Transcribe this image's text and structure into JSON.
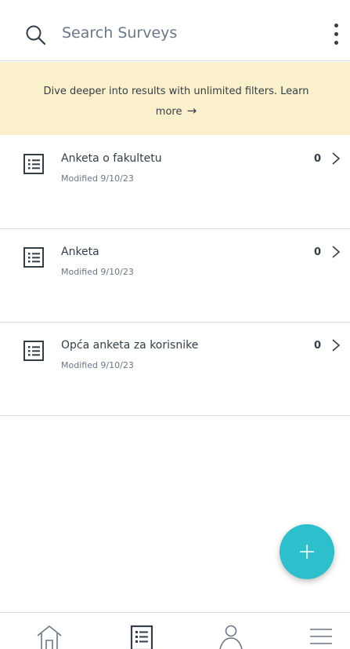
{
  "search": {
    "placeholder": "Search Surveys",
    "icon": "search-icon",
    "menu_icon": "more-vertical-icon"
  },
  "banner": {
    "text": "Dive deeper into results with unlimited filters. Learn more",
    "arrow": "→",
    "background_color": "#fbf0cc"
  },
  "surveys": [
    {
      "title": "Anketa o fakultetu",
      "modified": "Modified 9/10/23",
      "responses": "0",
      "icon": "survey-list-icon"
    },
    {
      "title": "Anketa",
      "modified": "Modified 9/10/23",
      "responses": "0",
      "icon": "survey-list-icon"
    },
    {
      "title": "Opća anketa za korisnike",
      "modified": "Modified 9/10/23",
      "responses": "0",
      "icon": "survey-list-icon"
    }
  ],
  "fab": {
    "icon": "plus-icon",
    "color": "#2bc0cb"
  },
  "bottom_nav": {
    "items": [
      {
        "name": "home",
        "icon": "home-icon"
      },
      {
        "name": "surveys",
        "icon": "survey-list-icon",
        "active": true
      },
      {
        "name": "contacts",
        "icon": "person-icon"
      },
      {
        "name": "menu",
        "icon": "hamburger-menu-icon"
      }
    ]
  },
  "colors": {
    "text": "#333e48",
    "muted": "#6b7787",
    "divider": "#d9dcde",
    "accent": "#2bc0cb"
  }
}
